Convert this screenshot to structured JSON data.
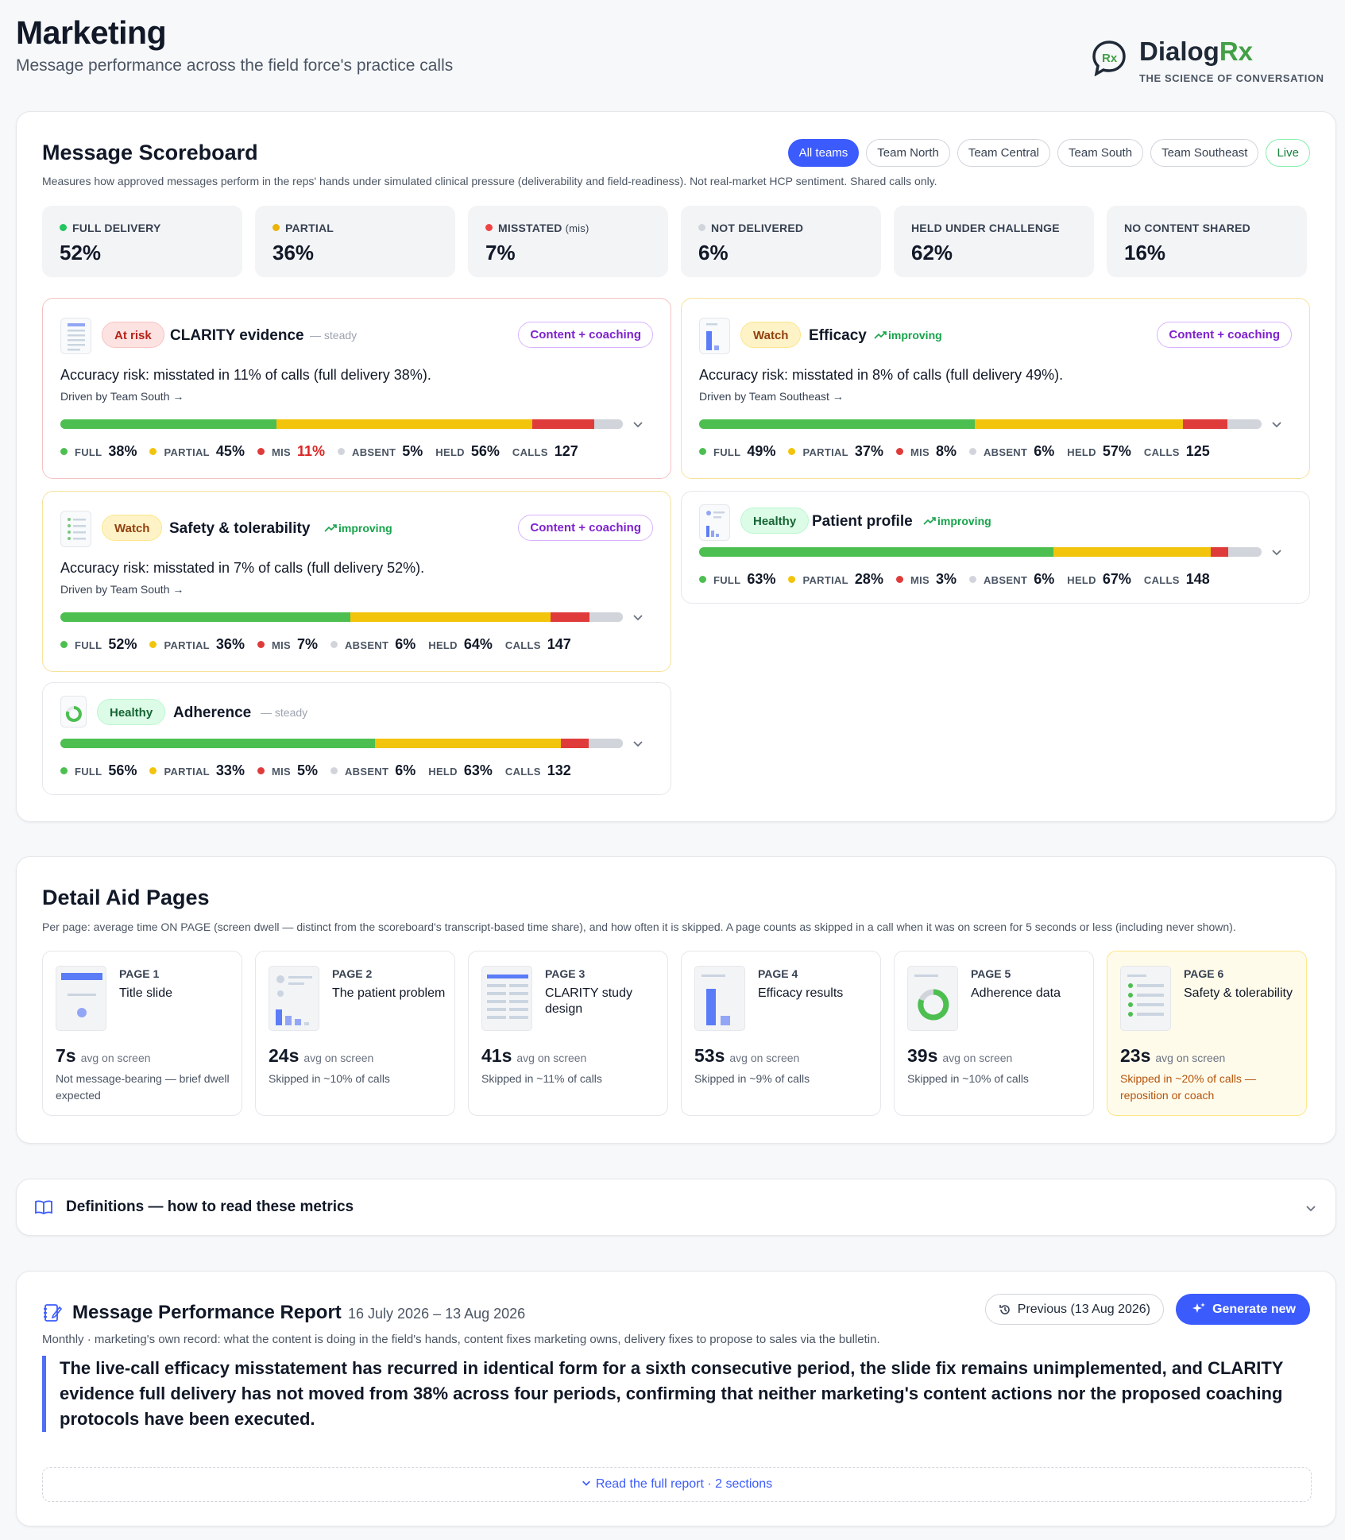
{
  "header": {
    "title": "Marketing",
    "subtitle": "Message performance across the field force's practice calls",
    "brand": {
      "name_main": "Dialog",
      "name_accent": "Rx",
      "tagline": "THE SCIENCE OF CONVERSATION",
      "mark_text": "Rx"
    }
  },
  "scoreboard": {
    "title": "Message Scoreboard",
    "description": "Measures how approved messages perform in the reps' hands under simulated clinical pressure (deliverability and field-readiness). Not real-market HCP sentiment. Shared calls only.",
    "teams": [
      "All teams",
      "Team North",
      "Team Central",
      "Team South",
      "Team Southeast"
    ],
    "active_team": "All teams",
    "live_label": "Live",
    "kpis": [
      {
        "label": "FULL DELIVERY",
        "value": "52%",
        "dot": "#22c55e"
      },
      {
        "label": "PARTIAL",
        "value": "36%",
        "dot": "#eab308"
      },
      {
        "label": "MISSTATED",
        "sub": "(mis)",
        "value": "7%",
        "dot": "#ef4444"
      },
      {
        "label": "NOT DELIVERED",
        "value": "6%",
        "dot": "#d1d5db"
      },
      {
        "label": "HELD UNDER CHALLENGE",
        "value": "62%"
      },
      {
        "label": "NO CONTENT SHARED",
        "value": "16%"
      }
    ],
    "stat_labels": {
      "full": "FULL",
      "partial": "PARTIAL",
      "mis": "MIS",
      "absent": "ABSENT",
      "held": "HELD",
      "calls": "CALLS"
    },
    "messages": [
      {
        "status": "At risk",
        "name": "CLARITY evidence",
        "trend": "— steady",
        "recommendation": "Content + coaching",
        "risk_text": "Accuracy risk: misstated in 11% of calls (full delivery 38%).",
        "driven_by": "Driven by Team South →",
        "full": 38,
        "partial": 45,
        "mis": 11,
        "absent": 5,
        "held": "56%",
        "calls": "127",
        "full_t": "38%",
        "partial_t": "45%",
        "mis_t": "11%",
        "absent_t": "5%"
      },
      {
        "status": "Watch",
        "name": "Efficacy",
        "trend": "improving",
        "recommendation": "Content + coaching",
        "risk_text": "Accuracy risk: misstated in 8% of calls (full delivery 49%).",
        "driven_by": "Driven by Team Southeast →",
        "full": 49,
        "partial": 37,
        "mis": 8,
        "absent": 6,
        "held": "57%",
        "calls": "125",
        "full_t": "49%",
        "partial_t": "37%",
        "mis_t": "8%",
        "absent_t": "6%"
      },
      {
        "status": "Watch",
        "name": "Safety & tolerability",
        "trend": "improving",
        "recommendation": "Content + coaching",
        "risk_text": "Accuracy risk: misstated in 7% of calls (full delivery 52%).",
        "driven_by": "Driven by Team South →",
        "full": 52,
        "partial": 36,
        "mis": 7,
        "absent": 6,
        "held": "64%",
        "calls": "147",
        "full_t": "52%",
        "partial_t": "36%",
        "mis_t": "7%",
        "absent_t": "6%"
      },
      {
        "status": "Healthy",
        "name": "Patient profile",
        "trend": "improving",
        "full": 63,
        "partial": 28,
        "mis": 3,
        "absent": 6,
        "held": "67%",
        "calls": "148",
        "full_t": "63%",
        "partial_t": "28%",
        "mis_t": "3%",
        "absent_t": "6%"
      },
      {
        "status": "Healthy",
        "name": "Adherence",
        "trend": "— steady",
        "full": 56,
        "partial": 33,
        "mis": 5,
        "absent": 6,
        "held": "63%",
        "calls": "132",
        "full_t": "56%",
        "partial_t": "33%",
        "mis_t": "5%",
        "absent_t": "6%"
      }
    ],
    "colors": {
      "full": "#4cbf50",
      "partial": "#f2c40c",
      "mis": "#e03b3b",
      "absent": "#d1d5db",
      "accent": "#3b5bfd"
    }
  },
  "detail_aid": {
    "title": "Detail Aid Pages",
    "description": "Per page: average time ON PAGE (screen dwell — distinct from the scoreboard's transcript-based time share), and how often it is skipped. A page counts as skipped in a call when it was on screen for 5 seconds or less (including never shown).",
    "dwell_suffix": "avg on screen",
    "pages": [
      {
        "num": "PAGE 1",
        "name": "Title slide",
        "dwell": "7s",
        "note": "Not message-bearing — brief dwell expected"
      },
      {
        "num": "PAGE 2",
        "name": "The patient problem",
        "dwell": "24s",
        "note": "Skipped in ~10% of calls"
      },
      {
        "num": "PAGE 3",
        "name": "CLARITY study design",
        "dwell": "41s",
        "note": "Skipped in ~11% of calls"
      },
      {
        "num": "PAGE 4",
        "name": "Efficacy results",
        "dwell": "53s",
        "note": "Skipped in ~9% of calls"
      },
      {
        "num": "PAGE 5",
        "name": "Adherence data",
        "dwell": "39s",
        "note": "Skipped in ~10% of calls"
      },
      {
        "num": "PAGE 6",
        "name": "Safety & tolerability",
        "dwell": "23s",
        "note": "Skipped in ~20% of calls — reposition or coach"
      }
    ]
  },
  "definitions": {
    "title": "Definitions — how to read these metrics"
  },
  "report": {
    "title": "Message Performance Report",
    "date_range": "16 July 2026 – 13 Aug 2026",
    "description": "Monthly · marketing's own record: what the content is doing in the field's hands, content fixes marketing owns, delivery fixes to propose to sales via the bulletin.",
    "previous_label": "Previous (13 Aug 2026)",
    "generate_label": "Generate new",
    "summary": "The live-call efficacy misstatement has recurred in identical form for a sixth consecutive period, the slide fix remains unimplemented, and CLARITY evidence full delivery has not moved from 38% across four periods, confirming that neither marketing's content actions nor the proposed coaching protocols have been executed.",
    "read_more": "Read the full report · 2 sections"
  }
}
